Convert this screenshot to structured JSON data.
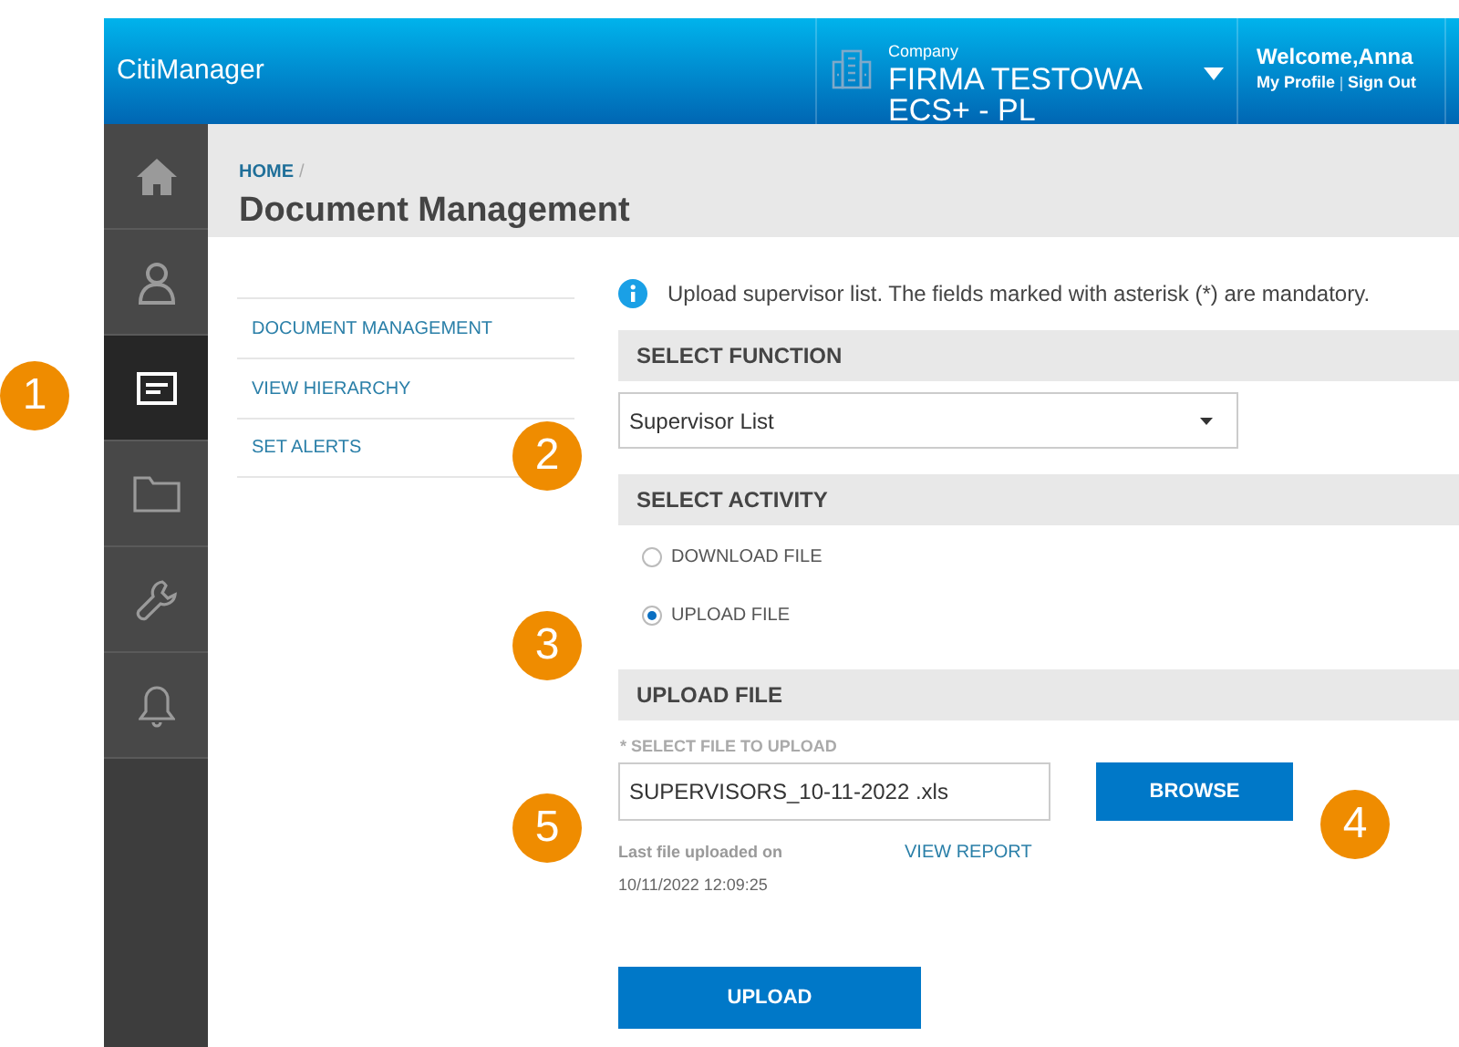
{
  "header": {
    "brand": "CitiManager",
    "company_label": "Company",
    "company_name": "FIRMA TESTOWA ECS+ - PL",
    "welcome": "Welcome,Anna",
    "links": [
      "My Profile",
      "Sign Out"
    ]
  },
  "sidebar": {
    "items": [
      {
        "kind": "home",
        "selected": false
      },
      {
        "kind": "user",
        "selected": false
      },
      {
        "kind": "document",
        "selected": true
      },
      {
        "kind": "folder",
        "selected": false
      },
      {
        "kind": "wrench",
        "selected": false
      },
      {
        "kind": "bell",
        "selected": false
      }
    ]
  },
  "breadcrumb": [
    "HOME",
    "/"
  ],
  "title": "Document Management",
  "subnav": {
    "items": [
      {
        "label": "DOCUMENT MANAGEMENT"
      },
      {
        "label": "VIEW HIERARCHY"
      },
      {
        "label": "SET ALERTS"
      }
    ]
  },
  "info": "Upload supervisor list. The fields marked with asterisk (*) are mandatory.",
  "select_function": {
    "heading": "SELECT FUNCTION",
    "value": "Supervisor List"
  },
  "select_activity": {
    "heading": "SELECT ACTIVITY",
    "options": [
      {
        "label": "DOWNLOAD FILE",
        "selected": false
      },
      {
        "label": "UPLOAD FILE",
        "selected": true
      }
    ]
  },
  "upload_file": {
    "heading": "UPLOAD FILE",
    "field_label": "* SELECT FILE TO UPLOAD",
    "value": "SUPERVISORS_10-11-2022 .xls",
    "browse": "BROWSE",
    "last_upload_label": "Last file uploaded on",
    "last_upload_time": "10/11/2022 12:09:25",
    "view_report": "VIEW REPORT",
    "upload": "UPLOAD"
  },
  "callouts": [
    "1",
    "2",
    "3",
    "4",
    "5"
  ]
}
